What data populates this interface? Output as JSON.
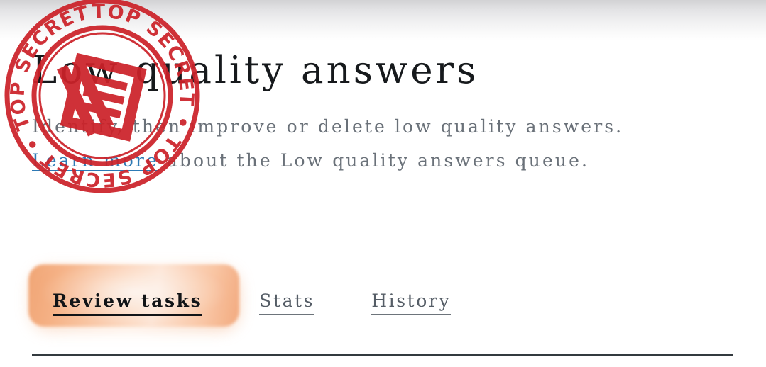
{
  "page": {
    "title": "Low quality answers",
    "description_line1": "Identify, then improve or delete low quality answers.",
    "description_prefix": "",
    "link_label": "Learn more",
    "description_after_link": " about the Low quality answers queue."
  },
  "tabs": [
    {
      "label": "Review tasks",
      "active": true
    },
    {
      "label": "Stats",
      "active": false
    },
    {
      "label": "History",
      "active": false
    }
  ],
  "stamp": {
    "ring_text": "TOP SECRET  •  TOP SECRET  •  TOP SECRET  •  TOP SECRET  •  ",
    "word": "TOP SECRET",
    "repeat_count": 4,
    "separator": "•",
    "color": "#cc2229",
    "emblem": "classified-document-emblem"
  },
  "colors": {
    "title": "#16191c",
    "body_text": "#6a7179",
    "link": "#2d7ab5",
    "tab_active_text": "#111417",
    "tab_inactive_text": "#555d66",
    "tab_highlight_start": "#f0a372",
    "tab_highlight_mid": "#fde4d4",
    "tab_highlight_end": "#f2a87c",
    "divider": "#333a3f",
    "stamp_red": "#cc2229",
    "background": "#ffffff"
  }
}
